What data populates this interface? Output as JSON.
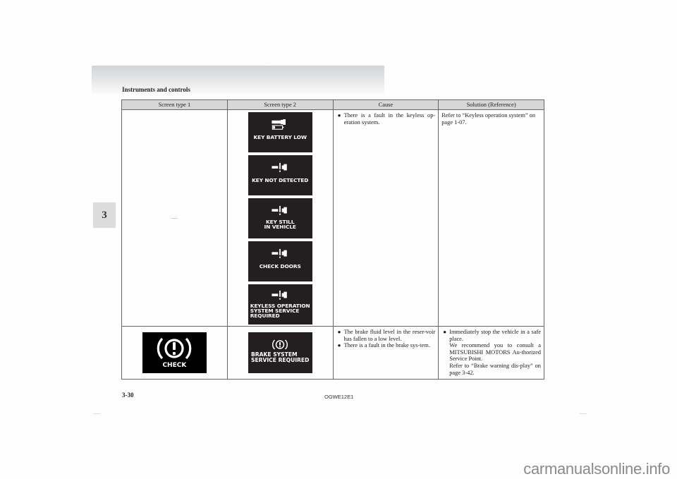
{
  "header": {
    "section_title": "Instruments and controls",
    "chapter_tab": "3"
  },
  "table": {
    "columns": [
      "Screen type 1",
      "Screen type 2",
      "Cause",
      "Solution (Reference)"
    ],
    "rows": [
      {
        "screen_type_1": "—",
        "screen_type_2": [
          {
            "icon": "key-battery-icon",
            "label": "KEY BATTERY LOW"
          },
          {
            "icon": "key-warning-icon",
            "label": "KEY NOT DETECTED"
          },
          {
            "icon": "key-warning-icon",
            "label": "KEY STILL\nIN VEHICLE"
          },
          {
            "icon": "key-warning-icon",
            "label": "CHECK DOORS"
          },
          {
            "icon": "key-warning-icon",
            "label": "KEYLESS OPERATION\nSYSTEM SERVICE\nREQUIRED"
          }
        ],
        "cause": [
          "There is a fault in the keyless op-eration system."
        ],
        "solution": "Refer to “Keyless operation system” on page 1-07."
      },
      {
        "screen_type_1": {
          "icon": "brake-warning-icon",
          "label": "CHECK"
        },
        "screen_type_2": {
          "icon": "brake-warning-icon",
          "label": "BRAKE SYSTEM\nSERVICE REQUIRED"
        },
        "cause": [
          "The brake fluid level in the reser-voir has fallen to a low level.",
          "There is a fault in the brake sys-tem."
        ],
        "solution": {
          "bullet": "Immediately stop the vehicle in a safe place.",
          "lines": [
            "We recommend you to consult a MITSUBISHI MOTORS Au-thorized Service Point.",
            "Refer to “Brake warning dis-play” on page 3-42."
          ]
        }
      }
    ]
  },
  "footer": {
    "page_number": "3-30",
    "doc_code": "OGWE12E1",
    "watermark": "carmanualsonline.info"
  }
}
